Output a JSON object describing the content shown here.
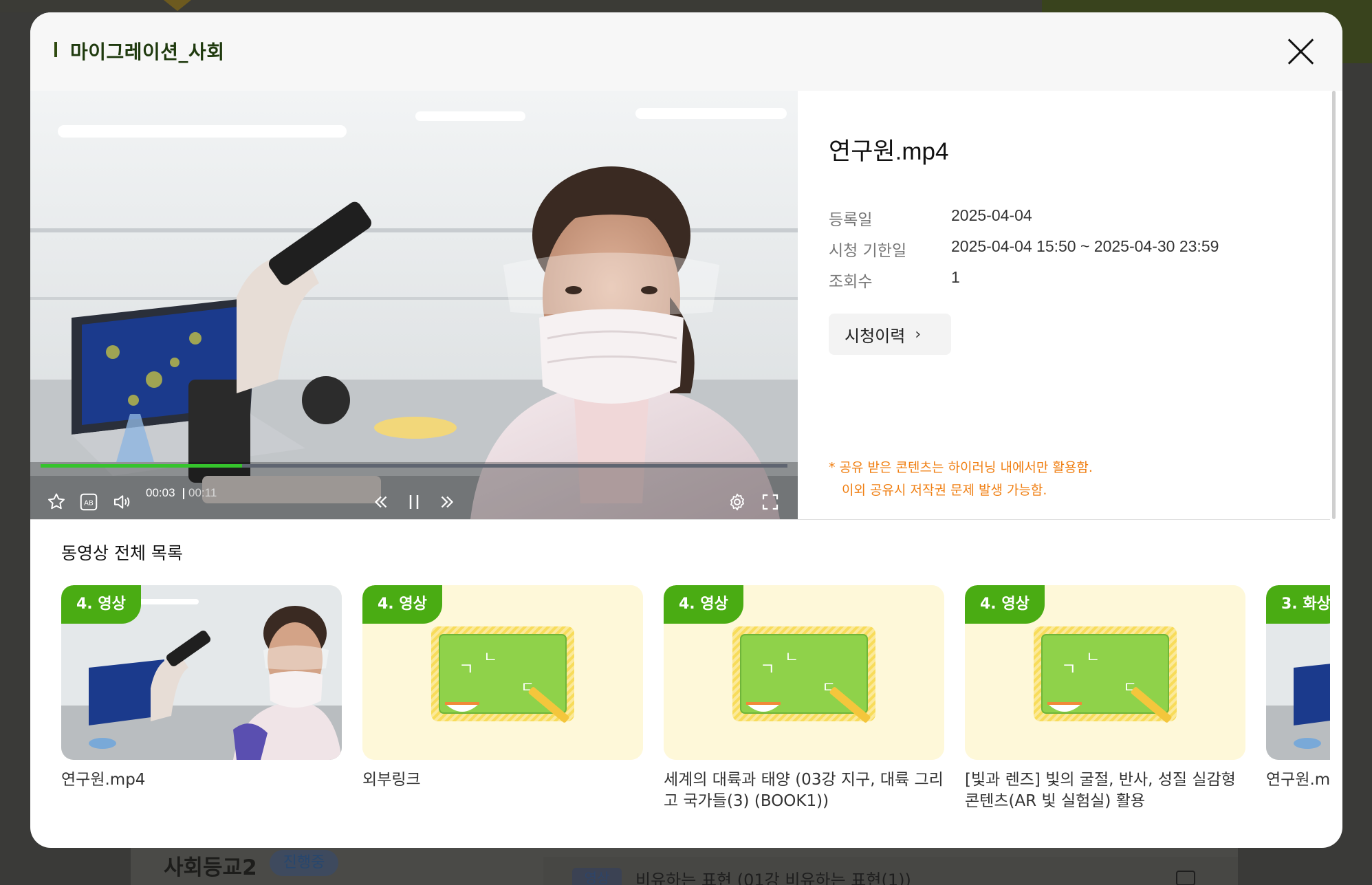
{
  "modal": {
    "title": "마이그레이션_사회",
    "close_label": "×"
  },
  "player": {
    "current_time": "00:03",
    "duration": "00:11",
    "progress_fraction": 0.27,
    "colors": {
      "progress": "#35c42c",
      "track": "#5f6571"
    },
    "icons": [
      "star-icon",
      "subtitle-icon",
      "volume-icon",
      "rewind-icon",
      "pause-icon",
      "forward-icon",
      "settings-icon",
      "fullscreen-icon"
    ]
  },
  "info": {
    "file_name": "연구원.mp4",
    "registered_label": "등록일",
    "registered_value": "2025-04-04",
    "period_label": "시청 기한일",
    "period_value": "2025-04-04 15:50 ~ 2025-04-30 23:59",
    "views_label": "조회수",
    "views_value": "1",
    "history_button": "시청이력",
    "notice_line1": "* 공유 받은 콘텐츠는 하이러닝 내에서만 활용함.",
    "notice_line2": "이외 공유시 저작권 문제 발생 가능함.",
    "notice_color": "#f07f12"
  },
  "video_list": {
    "heading": "동영상 전체 목록",
    "items": [
      {
        "badge": "4. 영상",
        "title": "연구원.mp4",
        "thumb": "photo"
      },
      {
        "badge": "4. 영상",
        "title": "외부링크",
        "thumb": "board"
      },
      {
        "badge": "4. 영상",
        "title": "세계의 대륙과 태양 (03강 지구, 대륙 그리고 국가들(3) (BOOK1))",
        "thumb": "board"
      },
      {
        "badge": "4. 영상",
        "title": "[빛과 렌즈] 빛의 굴절, 반사, 성질 실감형 콘텐츠(AR 빛 실험실) 활용",
        "thumb": "board"
      },
      {
        "badge": "3. 화상",
        "title": "연구원.m",
        "thumb": "photo"
      }
    ],
    "badge_color": "#4aac13"
  },
  "background": {
    "course_title": "사회등교2",
    "course_status": "진행중",
    "list_tag": "영상",
    "list_text": "비유하는 표현 (01강 비유하는 표현(1))"
  }
}
